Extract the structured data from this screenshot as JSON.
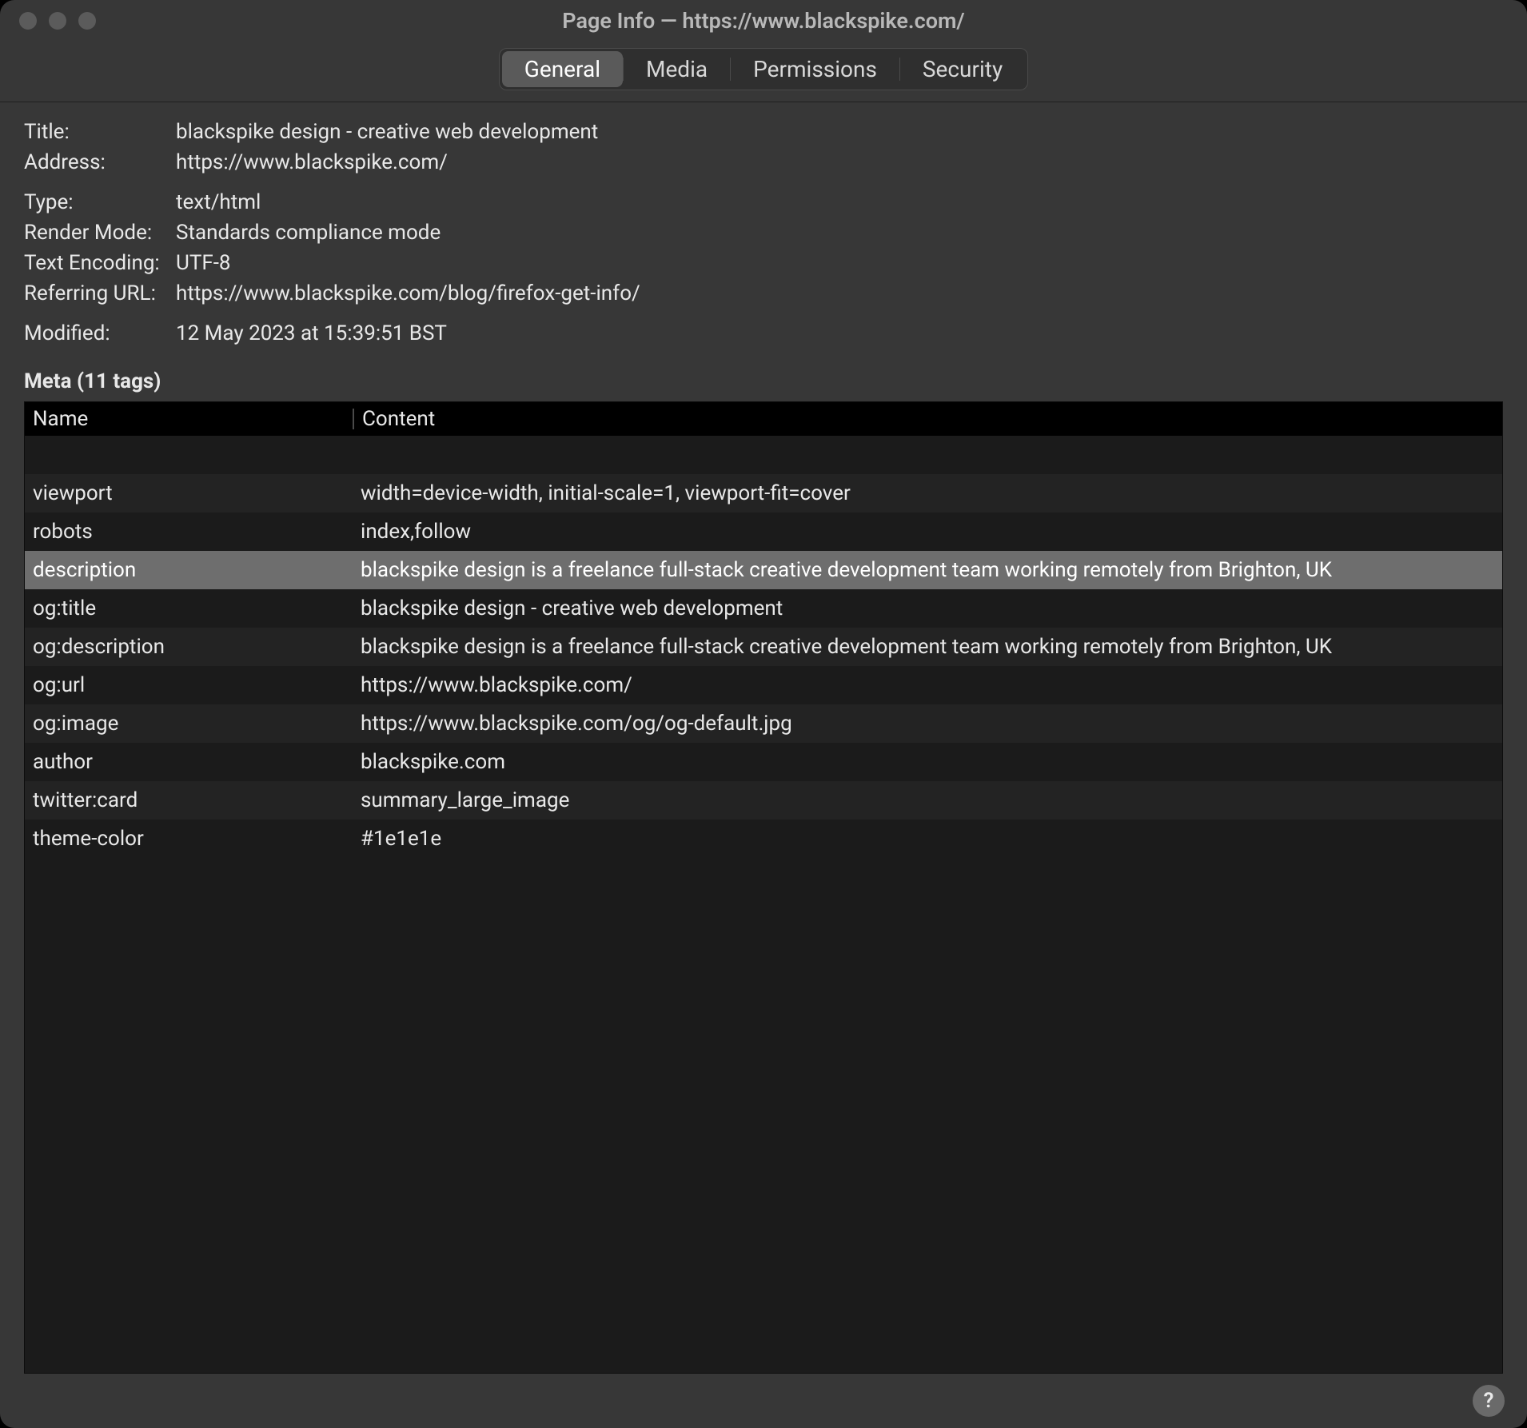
{
  "window": {
    "title": "Page Info — https://www.blackspike.com/"
  },
  "tabs": {
    "general": "General",
    "media": "Media",
    "permissions": "Permissions",
    "security": "Security",
    "active": "general"
  },
  "info": {
    "labels": {
      "title": "Title:",
      "address": "Address:",
      "type": "Type:",
      "render_mode": "Render Mode:",
      "text_encoding": "Text Encoding:",
      "referring_url": "Referring URL:",
      "modified": "Modified:"
    },
    "values": {
      "title": "blackspike design - creative web development",
      "address": "https://www.blackspike.com/",
      "type": "text/html",
      "render_mode": "Standards compliance mode",
      "text_encoding": "UTF-8",
      "referring_url": "https://www.blackspike.com/blog/firefox-get-info/",
      "modified": "12 May 2023 at 15:39:51 BST"
    }
  },
  "meta": {
    "header": "Meta (11 tags)",
    "columns": {
      "name": "Name",
      "content": "Content"
    },
    "selected_index": 3,
    "rows": [
      {
        "name": "",
        "content": ""
      },
      {
        "name": "viewport",
        "content": "width=device-width, initial-scale=1, viewport-fit=cover"
      },
      {
        "name": "robots",
        "content": "index,follow"
      },
      {
        "name": "description",
        "content": "blackspike design is a freelance full-stack creative development team working remotely from Brighton, UK"
      },
      {
        "name": "og:title",
        "content": "blackspike design - creative web development"
      },
      {
        "name": "og:description",
        "content": "blackspike design is a freelance full-stack creative development team working remotely from Brighton, UK"
      },
      {
        "name": "og:url",
        "content": "https://www.blackspike.com/"
      },
      {
        "name": "og:image",
        "content": "https://www.blackspike.com/og/og-default.jpg"
      },
      {
        "name": "author",
        "content": "blackspike.com"
      },
      {
        "name": "twitter:card",
        "content": "summary_large_image"
      },
      {
        "name": "theme-color",
        "content": "#1e1e1e"
      }
    ]
  },
  "footer": {
    "help": "?"
  }
}
